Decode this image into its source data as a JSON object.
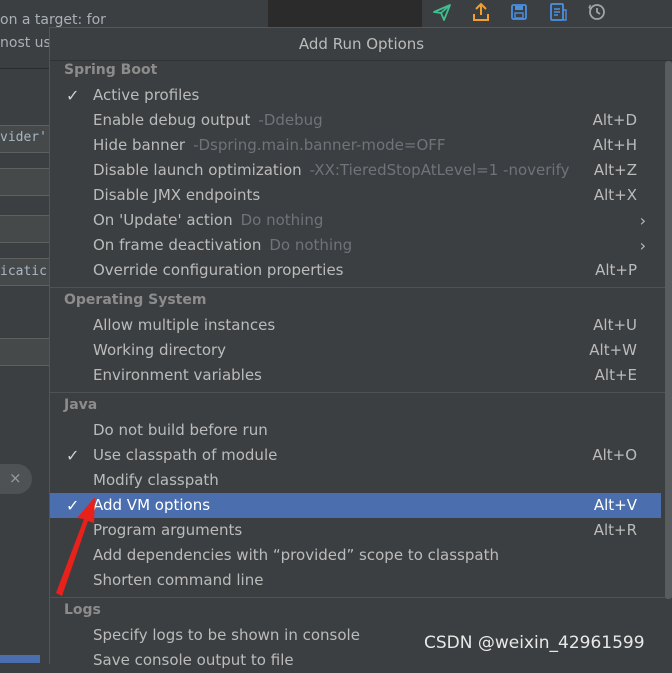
{
  "background": {
    "line1": "on a target: for",
    "line2": "nost usi",
    "field1": "vider'",
    "field2": "icatic",
    "chip_close": "×"
  },
  "toolbar": {
    "icons": [
      "send-icon",
      "upload-icon",
      "save-icon",
      "document-list-icon",
      "history-icon"
    ]
  },
  "popup": {
    "title": "Add Run Options",
    "sections": [
      {
        "title": "Spring Boot",
        "items": [
          {
            "checked": true,
            "label": "Active profiles",
            "hint": "",
            "shortcut": ""
          },
          {
            "checked": false,
            "label": "Enable debug output",
            "hint": "-Ddebug",
            "shortcut": "Alt+D"
          },
          {
            "checked": false,
            "label": "Hide banner",
            "hint": "-Dspring.main.banner-mode=OFF",
            "shortcut": "Alt+H"
          },
          {
            "checked": false,
            "label": "Disable launch optimization",
            "hint": "-XX:TieredStopAtLevel=1 -noverify",
            "shortcut": "Alt+Z"
          },
          {
            "checked": false,
            "label": "Disable JMX endpoints",
            "hint": "",
            "shortcut": "Alt+X"
          },
          {
            "checked": false,
            "label": "On 'Update' action",
            "hint": "Do nothing",
            "shortcut": "",
            "submenu": true
          },
          {
            "checked": false,
            "label": "On frame deactivation",
            "hint": "Do nothing",
            "shortcut": "",
            "submenu": true
          },
          {
            "checked": false,
            "label": "Override configuration properties",
            "hint": "",
            "shortcut": "Alt+P"
          }
        ]
      },
      {
        "title": "Operating System",
        "items": [
          {
            "checked": false,
            "label": "Allow multiple instances",
            "hint": "",
            "shortcut": "Alt+U"
          },
          {
            "checked": false,
            "label": "Working directory",
            "hint": "",
            "shortcut": "Alt+W"
          },
          {
            "checked": false,
            "label": "Environment variables",
            "hint": "",
            "shortcut": "Alt+E"
          }
        ]
      },
      {
        "title": "Java",
        "items": [
          {
            "checked": false,
            "label": "Do not build before run",
            "hint": "",
            "shortcut": ""
          },
          {
            "checked": true,
            "label": "Use classpath of module",
            "hint": "",
            "shortcut": "Alt+O"
          },
          {
            "checked": false,
            "label": "Modify classpath",
            "hint": "",
            "shortcut": ""
          },
          {
            "checked": true,
            "label": "Add VM options",
            "hint": "",
            "shortcut": "Alt+V",
            "selected": true
          },
          {
            "checked": false,
            "label": "Program arguments",
            "hint": "",
            "shortcut": "Alt+R"
          },
          {
            "checked": false,
            "label": "Add dependencies with “provided” scope to classpath",
            "hint": "",
            "shortcut": ""
          },
          {
            "checked": false,
            "label": "Shorten command line",
            "hint": "",
            "shortcut": ""
          }
        ]
      },
      {
        "title": "Logs",
        "items": [
          {
            "checked": false,
            "label": "Specify logs to be shown in console",
            "hint": "",
            "shortcut": ""
          },
          {
            "checked": false,
            "label": "Save console output to file",
            "hint": "",
            "shortcut": ""
          }
        ]
      }
    ]
  },
  "watermark": "CSDN @weixin_42961599",
  "colors": {
    "popup_bg": "#3c3f41",
    "selection": "#4b6eaf",
    "hint": "#6f737a",
    "annotation_arrow": "#e8211b"
  }
}
